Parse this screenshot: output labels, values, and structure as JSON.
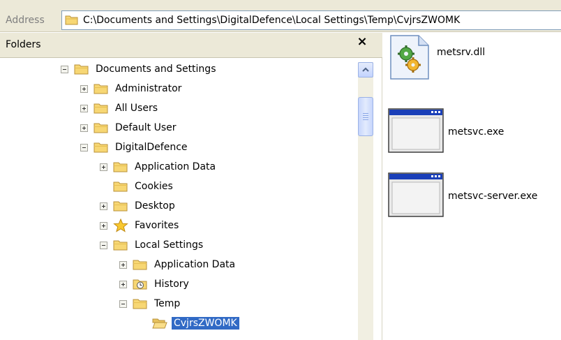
{
  "address": {
    "label": "Address",
    "path": "C:\\Documents and Settings\\DigitalDefence\\Local Settings\\Temp\\CvjrsZWOMK"
  },
  "folders_pane": {
    "title": "Folders",
    "close_glyph": "×"
  },
  "tree": [
    {
      "label": "Documents and Settings",
      "expander": "minus",
      "icon": "folder-icon"
    },
    {
      "label": "Administrator",
      "expander": "plus",
      "icon": "folder-icon"
    },
    {
      "label": "All Users",
      "expander": "plus",
      "icon": "folder-icon"
    },
    {
      "label": "Default User",
      "expander": "plus",
      "icon": "folder-icon"
    },
    {
      "label": "DigitalDefence",
      "expander": "minus",
      "icon": "folder-icon"
    },
    {
      "label": "Application Data",
      "expander": "plus",
      "icon": "folder-icon"
    },
    {
      "label": "Cookies",
      "expander": "none",
      "icon": "folder-icon"
    },
    {
      "label": "Desktop",
      "expander": "plus",
      "icon": "folder-icon"
    },
    {
      "label": "Favorites",
      "expander": "plus",
      "icon": "star-icon"
    },
    {
      "label": "Local Settings",
      "expander": "minus",
      "icon": "folder-icon"
    },
    {
      "label": "Application Data",
      "expander": "plus",
      "icon": "folder-icon"
    },
    {
      "label": "History",
      "expander": "plus",
      "icon": "history-folder-icon"
    },
    {
      "label": "Temp",
      "expander": "minus",
      "icon": "folder-icon"
    },
    {
      "label": "CvjrsZWOMK",
      "expander": "none",
      "icon": "open-folder-icon",
      "selected": true
    }
  ],
  "files": [
    {
      "name": "metsrv.dll",
      "icon": "dll-file-icon"
    },
    {
      "name": "metsvc.exe",
      "icon": "exe-window-icon"
    },
    {
      "name": "metsvc-server.exe",
      "icon": "exe-window-icon"
    }
  ],
  "colors": {
    "selection": "#316ac5",
    "toolbar_bg": "#ece9d8",
    "folder_yellow": "#f7d774"
  }
}
